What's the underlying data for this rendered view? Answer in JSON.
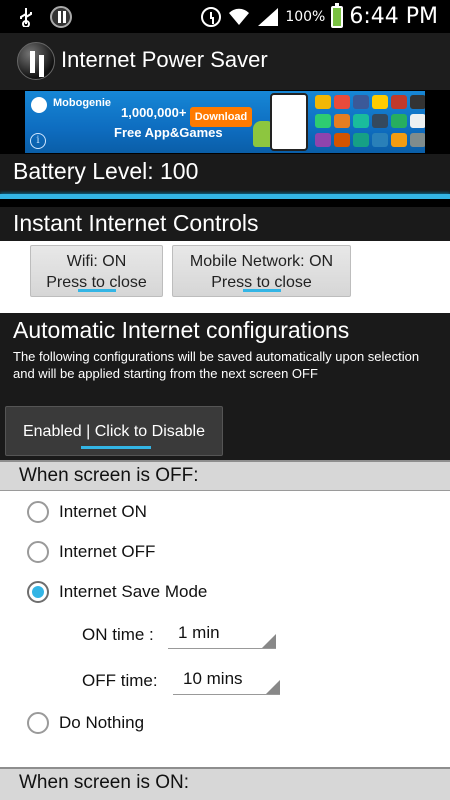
{
  "status_bar": {
    "battery_percent": "100%",
    "time": "6:44 PM"
  },
  "app": {
    "title": "Internet Power Saver"
  },
  "ad": {
    "brand": "Mobogenie",
    "count": "1,000,000+",
    "tagline": "Free App&Games",
    "download_label": "Download",
    "info_glyph": "i"
  },
  "battery": {
    "label": "Battery Level: 100"
  },
  "instant": {
    "title": "Instant Internet Controls",
    "wifi_line1": "Wifi: ON",
    "wifi_line2": "Press to close",
    "mobile_line1": "Mobile Network: ON",
    "mobile_line2": "Press to close"
  },
  "automatic": {
    "title": "Automatic Internet configurations",
    "description": "The following configurations will be saved automatically upon selection and will be applied starting from the next screen OFF",
    "toggle_label": "Enabled | Click to Disable"
  },
  "screen_off": {
    "header": "When screen is OFF:",
    "options": [
      {
        "label": "Internet ON",
        "checked": false
      },
      {
        "label": "Internet OFF",
        "checked": false
      },
      {
        "label": "Internet Save Mode",
        "checked": true
      },
      {
        "label": "Do Nothing",
        "checked": false
      }
    ],
    "on_time_label": "ON time :",
    "on_time_value": "1 min",
    "off_time_label": "OFF time:",
    "off_time_value": "10 mins"
  },
  "screen_on": {
    "header": "When screen is ON:"
  }
}
